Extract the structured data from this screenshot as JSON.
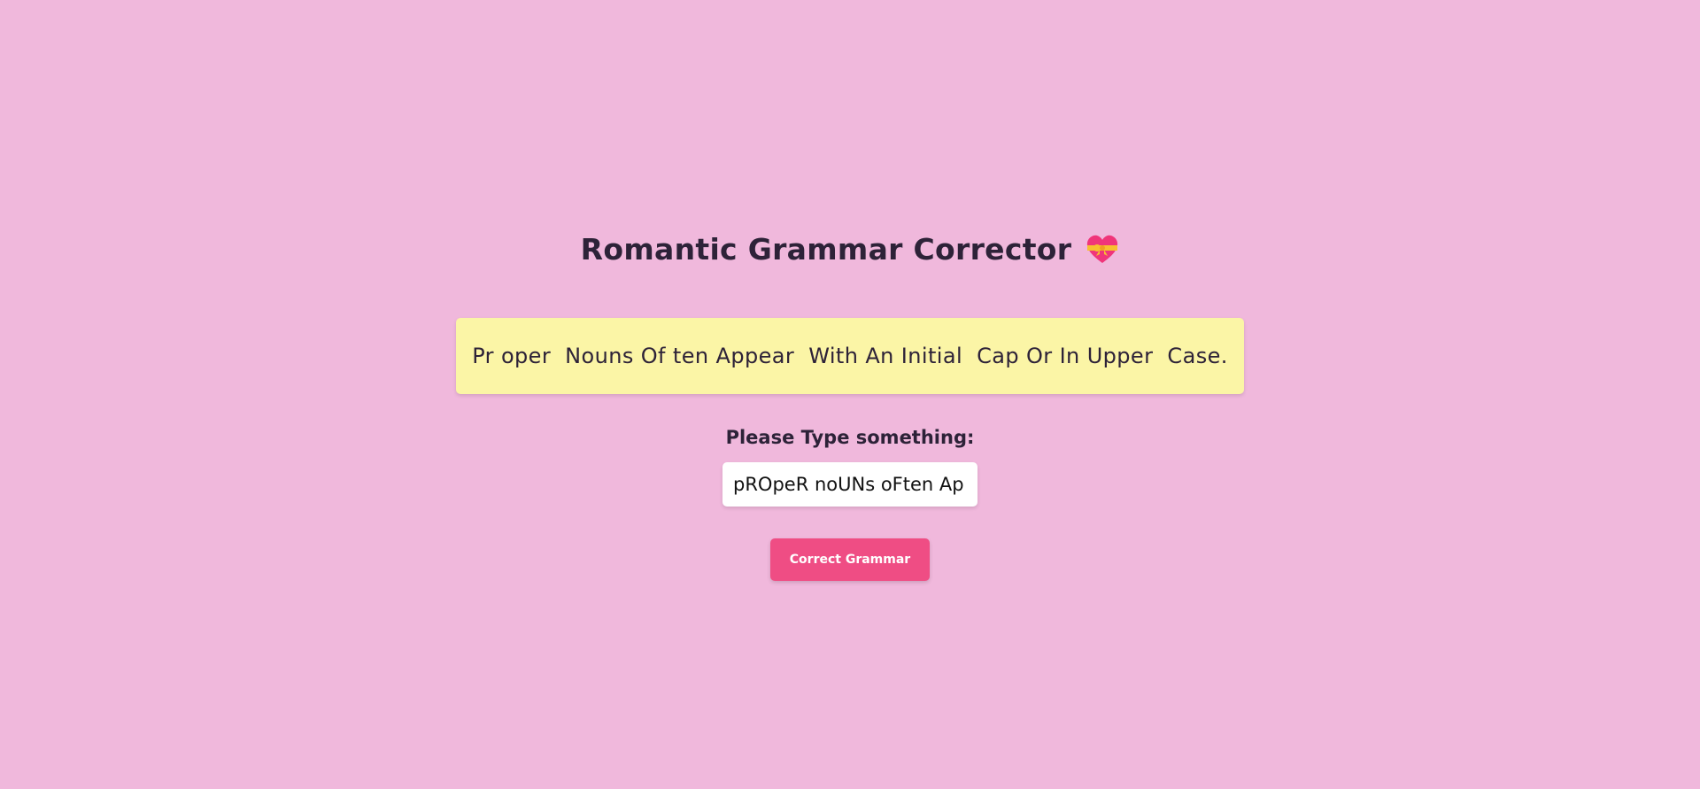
{
  "app": {
    "title": "Romantic Grammar Corrector",
    "title_icon": "heart-with-ribbon-icon"
  },
  "output": {
    "text": "Pr oper  Nouns Of ten Appear  With An Initial  Cap Or In Upper  Case."
  },
  "form": {
    "prompt_label": "Please Type something:",
    "input_value": "pROpeR noUNs oFten Ap",
    "button_label": "Correct Grammar"
  },
  "colors": {
    "background": "#f0b8dc",
    "output_box": "#fbf5a6",
    "button": "#ef4d84",
    "text": "#2d2238"
  }
}
